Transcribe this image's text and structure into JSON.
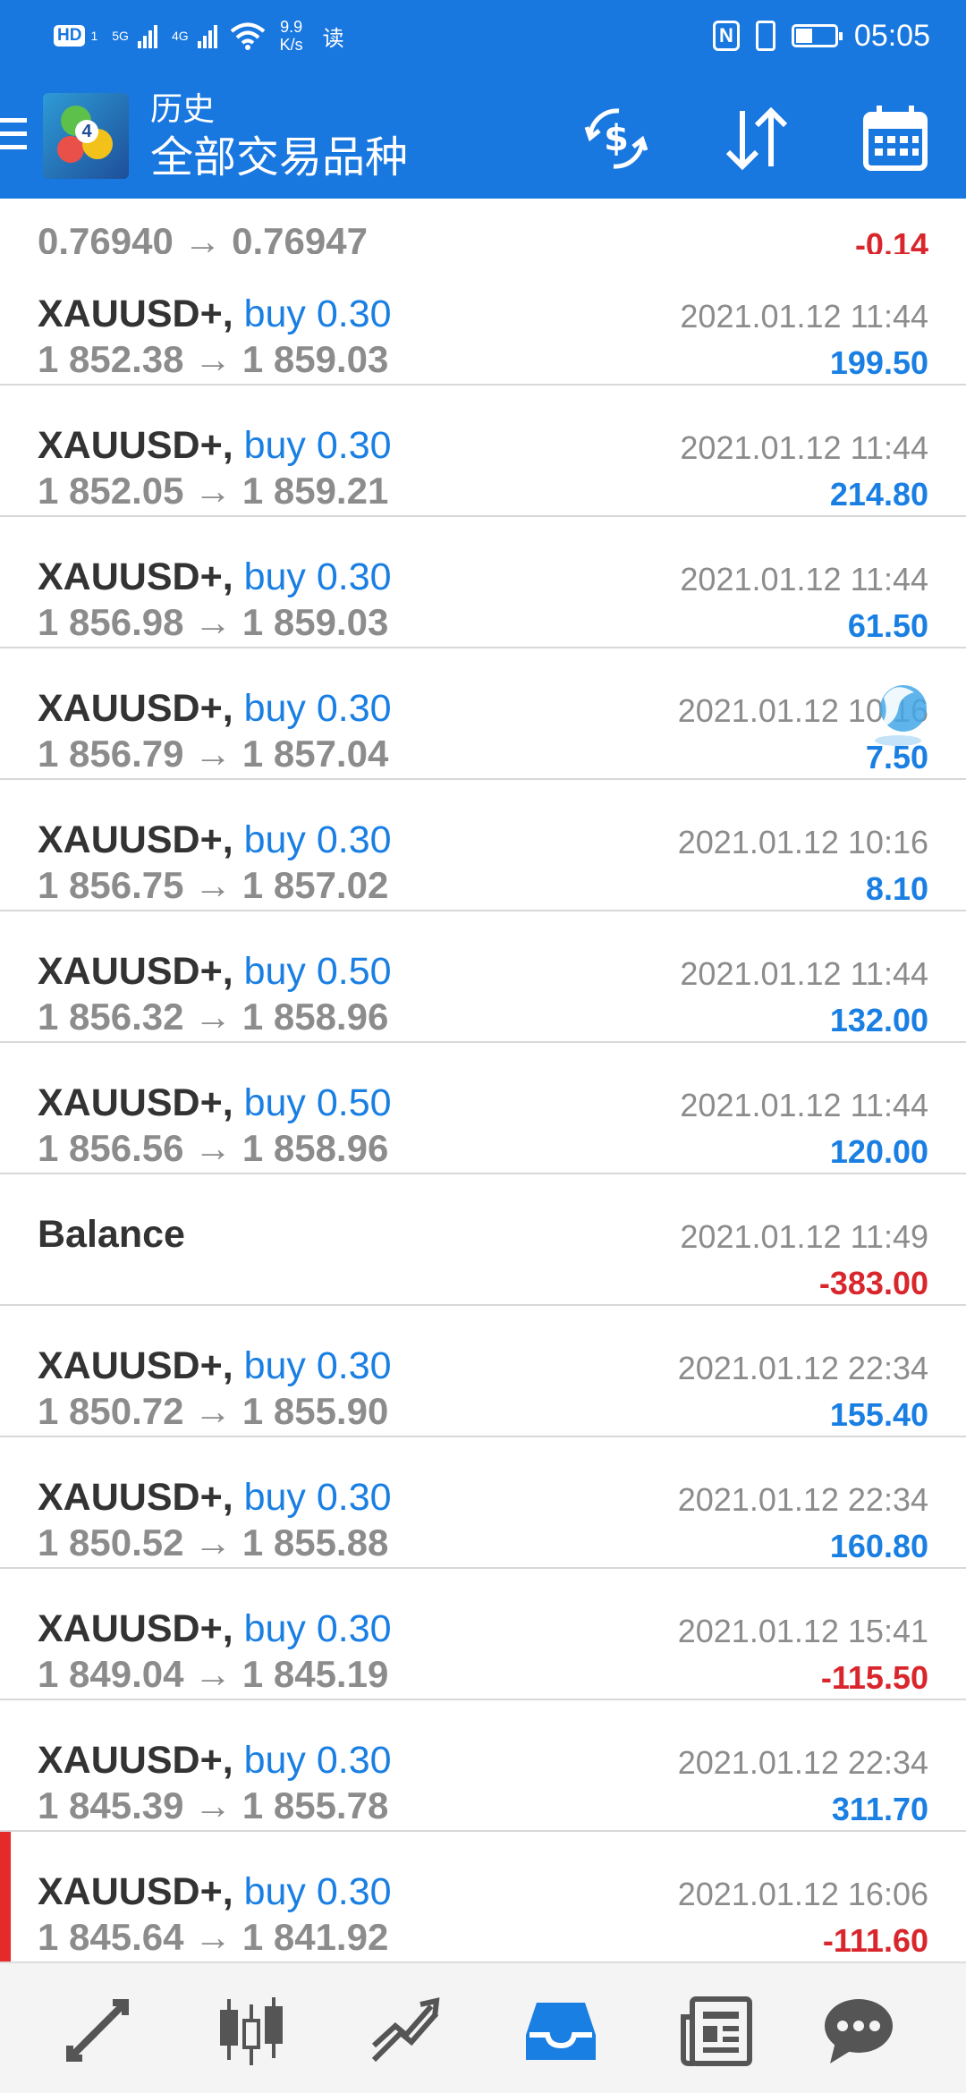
{
  "status_bar": {
    "hd": "HD",
    "hd_sub": "1",
    "net1": "5G",
    "net2": "4G",
    "speed_value": "9.9",
    "speed_unit": "K/s",
    "read_label": "读",
    "nfc": "N",
    "time": "05:05"
  },
  "header": {
    "subtitle": "历史",
    "title": "全部交易品种",
    "logo_number": "4",
    "icons": [
      "menu-icon",
      "currency-exchange-icon",
      "sort-icon",
      "calendar-icon"
    ]
  },
  "partial_row": {
    "prices": "0.76940 → 0.76947",
    "profit": "-0.14"
  },
  "trades": [
    {
      "symbol": "XAUUSD+",
      "side": "buy 0.30",
      "prices": "1 852.38 → 1 859.03",
      "time": "2021.01.12 11:44",
      "profit": "199.50",
      "sign": "pos"
    },
    {
      "symbol": "XAUUSD+",
      "side": "buy 0.30",
      "prices": "1 852.05 → 1 859.21",
      "time": "2021.01.12 11:44",
      "profit": "214.80",
      "sign": "pos"
    },
    {
      "symbol": "XAUUSD+",
      "side": "buy 0.30",
      "prices": "1 856.98 → 1 859.03",
      "time": "2021.01.12 11:44",
      "profit": "61.50",
      "sign": "pos"
    },
    {
      "symbol": "XAUUSD+",
      "side": "buy 0.30",
      "prices": "1 856.79 → 1 857.04",
      "time": "2021.01.12 10:16",
      "profit": "7.50",
      "sign": "pos"
    },
    {
      "symbol": "XAUUSD+",
      "side": "buy 0.30",
      "prices": "1 856.75 → 1 857.02",
      "time": "2021.01.12 10:16",
      "profit": "8.10",
      "sign": "pos"
    },
    {
      "symbol": "XAUUSD+",
      "side": "buy 0.50",
      "prices": "1 856.32 → 1 858.96",
      "time": "2021.01.12 11:44",
      "profit": "132.00",
      "sign": "pos"
    },
    {
      "symbol": "XAUUSD+",
      "side": "buy 0.50",
      "prices": "1 856.56 → 1 858.96",
      "time": "2021.01.12 11:44",
      "profit": "120.00",
      "sign": "pos"
    },
    {
      "symbol": "Balance",
      "side": "",
      "prices": "",
      "time": "2021.01.12 11:49",
      "profit": "-383.00",
      "sign": "neg"
    },
    {
      "symbol": "XAUUSD+",
      "side": "buy 0.30",
      "prices": "1 850.72 → 1 855.90",
      "time": "2021.01.12 22:34",
      "profit": "155.40",
      "sign": "pos"
    },
    {
      "symbol": "XAUUSD+",
      "side": "buy 0.30",
      "prices": "1 850.52 → 1 855.88",
      "time": "2021.01.12 22:34",
      "profit": "160.80",
      "sign": "pos"
    },
    {
      "symbol": "XAUUSD+",
      "side": "buy 0.30",
      "prices": "1 849.04 → 1 845.19",
      "time": "2021.01.12 15:41",
      "profit": "-115.50",
      "sign": "neg"
    },
    {
      "symbol": "XAUUSD+",
      "side": "buy 0.30",
      "prices": "1 845.39 → 1 855.78",
      "time": "2021.01.12 22:34",
      "profit": "311.70",
      "sign": "pos"
    },
    {
      "symbol": "XAUUSD+",
      "side": "buy 0.30",
      "prices": "1 845.64 → 1 841.92",
      "time": "2021.01.12 16:06",
      "profit": "-111.60",
      "sign": "neg",
      "selected": true
    }
  ],
  "bottom_nav": [
    {
      "name": "quotes-icon",
      "active": false
    },
    {
      "name": "chart-icon",
      "active": false
    },
    {
      "name": "trade-icon",
      "active": false
    },
    {
      "name": "history-icon",
      "active": true
    },
    {
      "name": "news-icon",
      "active": false
    },
    {
      "name": "chat-icon",
      "active": false
    }
  ],
  "colors": {
    "header_bg": "#1977e0",
    "positive": "#1a7fe3",
    "negative": "#d9262c",
    "selected_marker": "#e52a2a",
    "nav_active": "#1a7fe3",
    "nav_inactive": "#555555"
  }
}
